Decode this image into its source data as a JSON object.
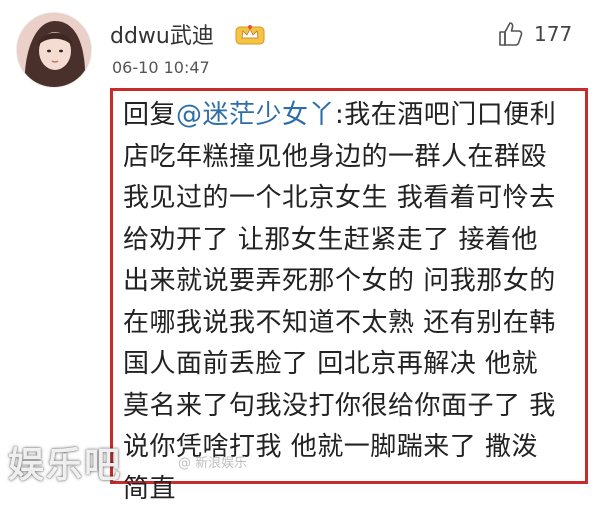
{
  "post": {
    "username": "ddwu武迪",
    "timestamp": "06-10 10:47",
    "like_count": "177",
    "badge_icon": "vip-crown-icon"
  },
  "comment": {
    "reply_prefix": "回复",
    "mention": "@迷茫少女丫",
    "separator": ":",
    "lines": [
      "我在酒吧门口便利",
      "店吃年糕撞见他身边的一群人在群殴",
      "我见过的一个北京女生 我看着可怜去",
      "给劝开了 让那女生赶紧走了 接着他",
      "出来就说要弄死那个女的 问我那女的",
      "在哪我说我不知道不太熟 还有别在韩",
      "国人面前丢脸了 回北京再解决 他就",
      "莫名来了句我没打你很给你面子了 我",
      "说你凭啥打我 他就一脚踹来了 撒泼",
      "简直"
    ]
  },
  "watermark": {
    "text": "娱乐吧",
    "sub": "@ 新浪娱乐"
  },
  "colors": {
    "border": "#c62c2c",
    "mention": "#2d6ea8",
    "badge": "#e3a42a"
  }
}
